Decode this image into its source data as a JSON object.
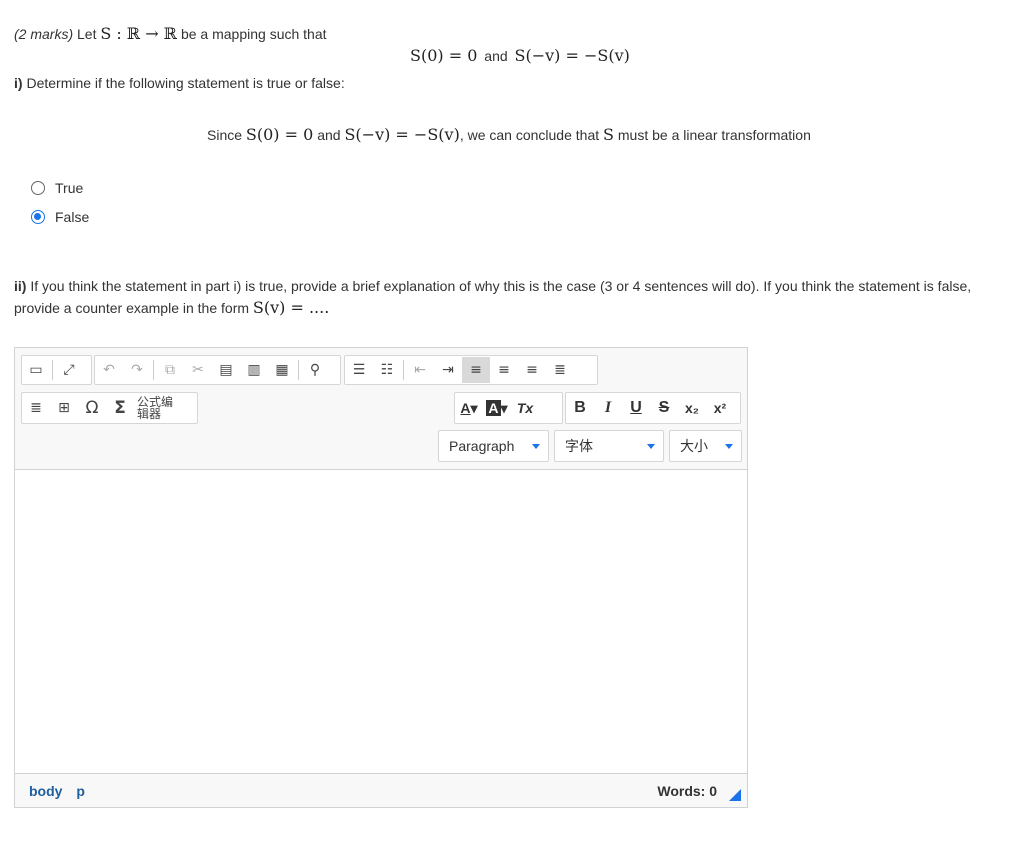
{
  "question": {
    "marks": "(2 marks)",
    "intro_text": "Let",
    "intro_math": "S : ℝ → ℝ",
    "intro_tail": "be a mapping such that",
    "eq_left": "S(0) = 0",
    "eq_and": "and",
    "eq_right": "S(−v) = −S(v)",
    "part_i_label": "i)",
    "part_i_text": "Determine if the following statement is true or false:",
    "statement_since": "Since",
    "statement_m1": "S(0) = 0",
    "statement_and": "and",
    "statement_m2": "S(−v) = −S(v)",
    "statement_tail": ", we can conclude that",
    "statement_m3": "S",
    "statement_end": "must be a linear transformation",
    "options": [
      {
        "label": "True",
        "checked": false
      },
      {
        "label": "False",
        "checked": true
      }
    ],
    "part_ii_label": "ii)",
    "part_ii_text": "If you think the statement in part i) is true, provide a brief explanation of why this is the case (3 or 4 sentences will do). If you think the statement is false, provide a counter example in the form",
    "part_ii_math": "S(v) = ....",
    "part_ii_end": ""
  },
  "editor": {
    "row1_icons": [
      "source-icon",
      "maximize-icon",
      "undo-icon",
      "redo-icon",
      "copy-icon",
      "cut-icon",
      "paste-icon",
      "paste-text-icon",
      "paste-word-icon",
      "find-icon",
      "numbered-list-icon",
      "bulleted-list-icon",
      "outdent-icon",
      "indent-icon",
      "align-left-icon",
      "align-center-icon",
      "align-right-icon",
      "justify-icon"
    ],
    "formula_editor_label": "公式编辑器",
    "text_color_label": "A",
    "bg_color_label": "A",
    "clear_format_label": "Tx",
    "bold_label": "B",
    "italic_label": "I",
    "underline_label": "U",
    "strike_label": "S",
    "subscript_label": "x₂",
    "superscript_label": "x²",
    "omega_label": "Ω",
    "sigma_label": "Σ",
    "format_select": "Paragraph",
    "font_select": "字体",
    "size_select": "大小",
    "path": [
      "body",
      "p"
    ],
    "word_count": "Words: 0"
  },
  "colors": {
    "accent": "#1a73e8",
    "path_link": "#1d5f9f"
  }
}
